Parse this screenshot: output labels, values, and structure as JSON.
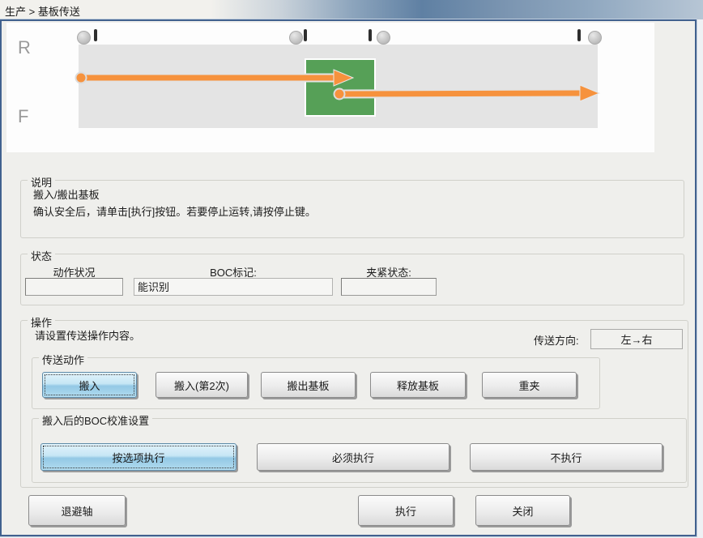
{
  "window": {
    "breadcrumb": "生产 > 基板传送"
  },
  "diagram": {
    "rear_label": "R",
    "front_label": "F",
    "icons": [
      "sensor-circle-icon",
      "sensor-bar-icon"
    ],
    "board_color": "#56a057",
    "arrow_color": "#f6923d",
    "conveyor_color": "#e4e4e4"
  },
  "description": {
    "title": "说明",
    "line1": "搬入/搬出基板",
    "line2": "确认安全后，请单击[执行]按钮。若要停止运转,请按停止键。"
  },
  "status": {
    "title": "状态",
    "action_label": "动作状况",
    "action_value": "",
    "boc_label": "BOC标记:",
    "boc_value": "能识别",
    "clamp_label": "夹紧状态:",
    "clamp_value": ""
  },
  "operation": {
    "title": "操作",
    "hint": "请设置传送操作内容。",
    "direction_label": "传送方向:",
    "direction_value": "左→右",
    "transfer": {
      "title": "传送动作",
      "buttons": [
        {
          "label": "搬入",
          "selected": true
        },
        {
          "label": "搬入(第2次)",
          "selected": false
        },
        {
          "label": "搬出基板",
          "selected": false
        },
        {
          "label": "释放基板",
          "selected": false
        },
        {
          "label": "重夹",
          "selected": false
        }
      ]
    },
    "boc": {
      "title": "搬入后的BOC校准设置",
      "buttons": [
        {
          "label": "按选项执行",
          "selected": true
        },
        {
          "label": "必须执行",
          "selected": false
        },
        {
          "label": "不执行",
          "selected": false
        }
      ]
    }
  },
  "footer": {
    "retract": "退避轴",
    "execute": "执行",
    "close": "关闭"
  },
  "colors": {
    "selected_button_blue": "#9ecfe8",
    "window_border": "#41618f"
  }
}
